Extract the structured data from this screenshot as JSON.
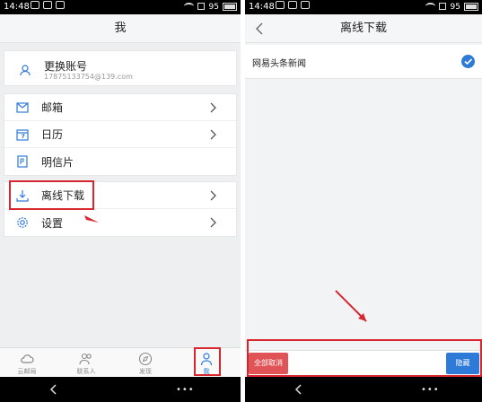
{
  "statusbar": {
    "time": "14:48",
    "battery_pct": "95"
  },
  "left": {
    "title": "我",
    "account": {
      "name": "更换账号",
      "email": "17875133754@139.com"
    },
    "menu_group1": [
      {
        "label": "邮箱",
        "icon": "mail-icon"
      },
      {
        "label": "日历",
        "icon": "calendar-icon"
      },
      {
        "label": "明信片",
        "icon": "postcard-icon"
      }
    ],
    "menu_group2": [
      {
        "label": "离线下载",
        "icon": "download-icon"
      },
      {
        "label": "设置",
        "icon": "gear-icon"
      }
    ],
    "nav": [
      {
        "label": "云邮局",
        "icon": "cloud-icon"
      },
      {
        "label": "联系人",
        "icon": "contacts-icon"
      },
      {
        "label": "发现",
        "icon": "compass-icon"
      },
      {
        "label": "我",
        "icon": "person-icon",
        "active": true
      }
    ]
  },
  "right": {
    "title": "离线下载",
    "item": {
      "label": "网易头条新闻",
      "checked": true
    },
    "cancel_all": "全部取消",
    "hide": "隐藏"
  },
  "colors": {
    "accent": "#2e7ad8",
    "highlight": "#d8262f",
    "cancel": "#e05457"
  }
}
